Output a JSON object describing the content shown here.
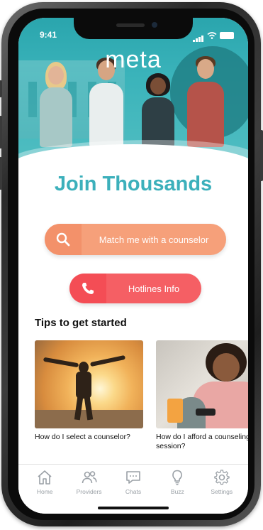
{
  "status_bar": {
    "time": "9:41"
  },
  "brand": {
    "logo": "meta"
  },
  "content": {
    "headline": "Join Thousands",
    "match_button": "Match me with a counselor",
    "hotlines_button": "Hotlines Info",
    "tips_title": "Tips to get started",
    "tips": [
      {
        "caption": "How do I select a counselor?"
      },
      {
        "caption": "How do I afford a counseling session?"
      }
    ]
  },
  "tabbar": {
    "items": [
      {
        "label": "Home",
        "icon": "home-icon"
      },
      {
        "label": "Providers",
        "icon": "people-icon"
      },
      {
        "label": "Chats",
        "icon": "chat-icon"
      },
      {
        "label": "Buzz",
        "icon": "lightbulb-icon"
      },
      {
        "label": "Settings",
        "icon": "gear-icon"
      }
    ]
  },
  "colors": {
    "teal": "#3cb0bb",
    "match": "#f6a07a",
    "hotline": "#f55f64",
    "tab_gray": "#9aa0a6"
  }
}
